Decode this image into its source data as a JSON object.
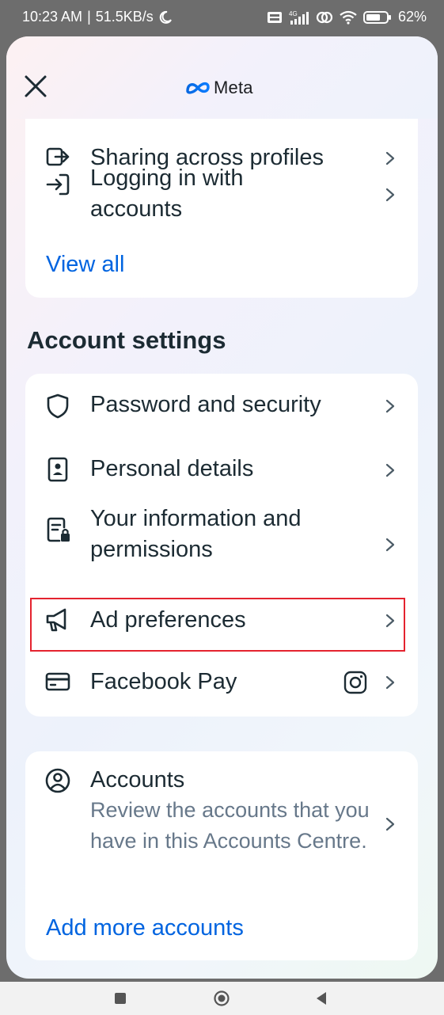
{
  "status_bar": {
    "time": "10:23 AM",
    "separator": "|",
    "speed": "51.5KB/s",
    "battery": "62%",
    "icons": [
      "moon-icon",
      "volte-icon",
      "4g-signal-icon",
      "hotspot-icon",
      "wifi-icon",
      "battery-icon"
    ]
  },
  "header": {
    "brand": "Meta",
    "close_icon": "close-icon"
  },
  "connected_card": {
    "partial_row_label": "Sharing across profiles",
    "rows": [
      {
        "label": "Logging in with accounts",
        "icon": "login-arrow-icon"
      }
    ],
    "view_all": "View all"
  },
  "account_settings": {
    "title": "Account settings",
    "rows": [
      {
        "label": "Password and security",
        "icon": "shield-icon"
      },
      {
        "label": "Personal details",
        "icon": "id-card-icon"
      },
      {
        "label": "Your information and permissions",
        "icon": "document-lock-icon"
      },
      {
        "label": "Ad preferences",
        "icon": "megaphone-icon"
      },
      {
        "label": "Facebook Pay",
        "icon": "credit-card-icon",
        "extra_icon": "instagram-icon"
      }
    ]
  },
  "accounts_card": {
    "title": "Accounts",
    "description": "Review the accounts that you have in this Accounts Centre.",
    "add_link": "Add more accounts",
    "icon": "person-circle-icon"
  },
  "nav_bar": {
    "buttons": [
      "recents-button",
      "home-button",
      "back-button"
    ]
  },
  "colors": {
    "link": "#0064e0",
    "text": "#1c2b33",
    "secondary_text": "#67788a",
    "highlight_border": "#e4232f"
  }
}
